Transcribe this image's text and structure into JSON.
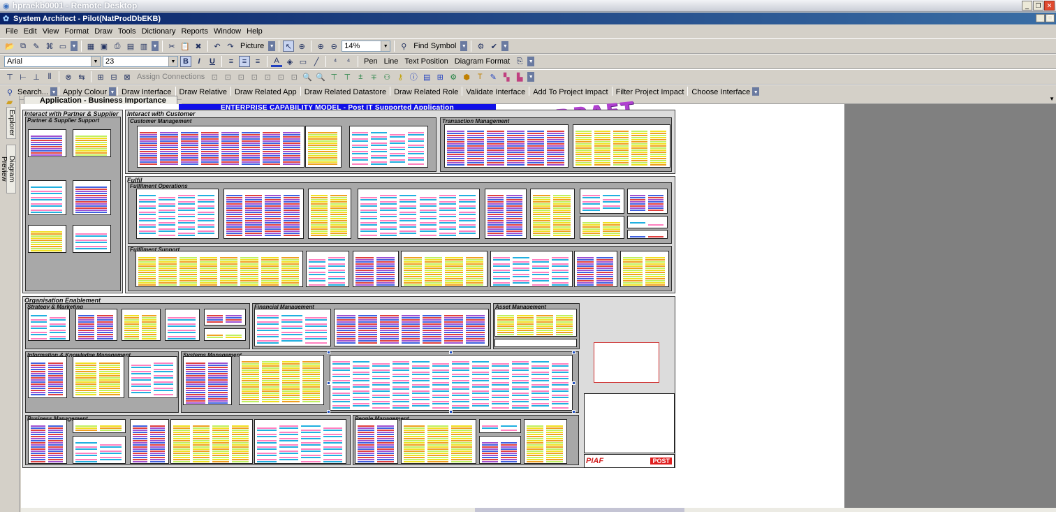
{
  "remote_desktop": {
    "title": "hpraekb0001 - Remote Desktop"
  },
  "app": {
    "title": "System Architect - Pilot(NatProdDbEKB)"
  },
  "menu": [
    "File",
    "Edit",
    "View",
    "Format",
    "Draw",
    "Tools",
    "Dictionary",
    "Reports",
    "Window",
    "Help"
  ],
  "toolbar1": {
    "picture": "Picture",
    "zoom": "14%",
    "find_symbol": "Find Symbol"
  },
  "toolbar2": {
    "font": "Arial",
    "size": "23",
    "pen": "Pen",
    "line": "Line",
    "text_position": "Text Position",
    "diagram_format": "Diagram Format"
  },
  "toolbar3": {
    "assign_connections": "Assign Connections"
  },
  "toolbar4": {
    "search": "Search...",
    "items": [
      "Apply Colour",
      "Draw Interface",
      "Draw Relative",
      "Draw Related App",
      "Draw Related Datastore",
      "Draw Related Role",
      "Validate Interface",
      "Add To Project Impact",
      "Filter Project Impact",
      "Choose Interface"
    ]
  },
  "side_tabs": {
    "explorer": "Explorer",
    "diagram_preview": "Diagram Preview"
  },
  "document_tab": "Application - Business Importance -...",
  "diagram": {
    "banner": "ENTERPRISE CAPABILITY MODEL - Post IT Supported Application",
    "draft": "DRAFT",
    "partner": {
      "title": "Interact with Partner & Supplier",
      "sub": "Partner & Supplier Support"
    },
    "customer": {
      "title": "Interact with Customer",
      "cust_mgmt": "Customer Management",
      "trans_mgmt": "Transaction Management"
    },
    "fulfil": {
      "title": "Fulfil",
      "ops": "Fulfilment Operations",
      "support": "Fulfilment Support"
    },
    "org": {
      "title": "Organisation Enablement",
      "strategy": "Strategy & Marketing",
      "financial": "Financial Management",
      "asset": "Asset Management",
      "info": "Information & Knowledge Management",
      "systems": "Systems Management",
      "business": "Business Management",
      "people": "People Management"
    },
    "logos": {
      "piaf": "PIAF",
      "post": "POST"
    }
  }
}
